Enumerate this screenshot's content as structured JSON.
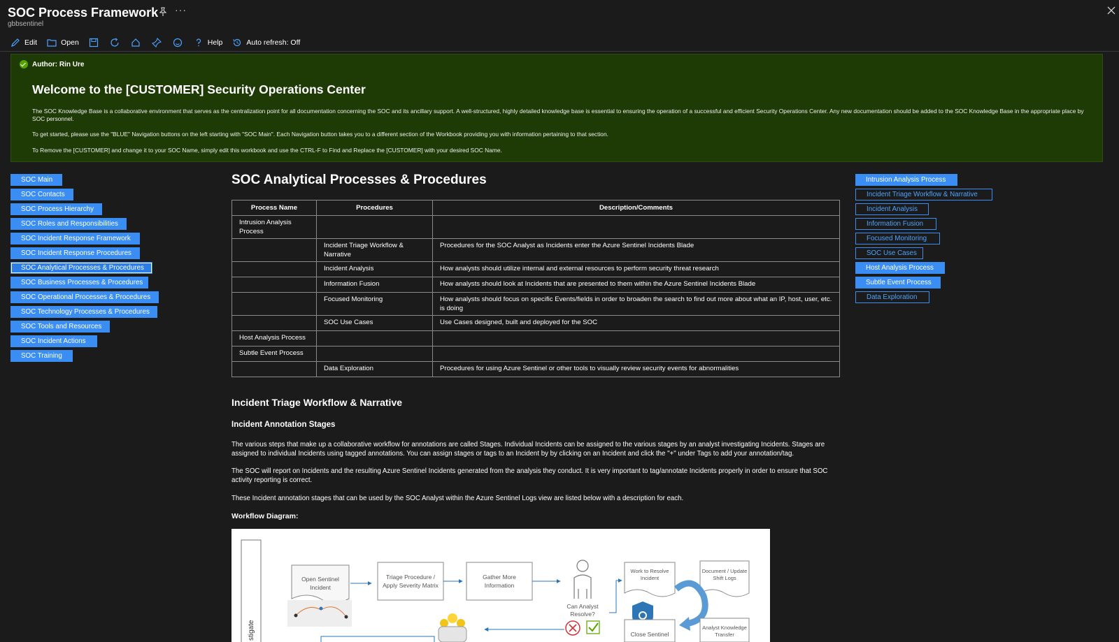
{
  "window": {
    "title": "SOC Process Framework",
    "subtitle": "gbbsentinel"
  },
  "toolbar": {
    "edit": "Edit",
    "open": "Open",
    "help": "Help",
    "auto_refresh": "Auto refresh: Off"
  },
  "banner": {
    "author": "Author: Rin Ure",
    "heading": "Welcome to the [CUSTOMER] Security Operations Center",
    "paragraphs": [
      "The SOC Knowledge Base is a collaborative environment that serves as the centralization point for all documentation concerning the SOC and its ancillary support. A well-structured, highly detailed knowledge base is essential to ensuring the operation of a successful and efficient Security Operations Center. Any new documentation should be added to the SOC Knowledge Base in the appropriate place by SOC personnel.",
      "To get started, please use the \"BLUE\" Navigation buttons on the left starting with \"SOC Main\". Each Navigation button takes you to a different section of the Workbook providing you with information pertaining to that section.",
      "To Remove the [CUSTOMER] and change it to your SOC Name, simply edit this workbook and use the CTRL-F to Find and Replace the [CUSTOMER] with your desired SOC Name."
    ]
  },
  "left_nav": [
    "SOC Main",
    "SOC Contacts",
    "SOC Process Hierarchy",
    "SOC Roles and Responsibilities",
    "SOC Incident Response Framework",
    "SOC Incident Response Procedures",
    "SOC Analytical Processes & Procedures",
    "SOC Business Processes & Procedures",
    "SOC Operational Processes & Procedures",
    "SOC Technology Processes & Procedures",
    "SOC Tools and Resources",
    "SOC Incident Actions",
    "SOC Training"
  ],
  "right_nav": [
    "Intrusion Analysis Process",
    "Incident Triage Workflow & Narrative",
    "Incident Analysis",
    "Information Fusion",
    "Focused Monitoring",
    "SOC Use Cases",
    "Host Analysis Process",
    "Subtle Event Process",
    "Data Exploration"
  ],
  "main": {
    "title": "SOC Analytical Processes & Procedures",
    "table": {
      "headers": [
        "Process Name",
        "Procedures",
        "Description/Comments"
      ],
      "rows": [
        [
          "Intrusion Analysis Process",
          "",
          ""
        ],
        [
          "",
          "Incident Triage Workflow & Narrative",
          "Procedures for the SOC Analyst as Incidents enter the Azure Sentinel Incidents Blade"
        ],
        [
          "",
          "Incident Analysis",
          "How analysts should utilize internal and external resources to perform security threat research"
        ],
        [
          "",
          "Information Fusion",
          "How analysts should look at Incidents that are presented to them within the Azure Sentinel Incidents Blade"
        ],
        [
          "",
          "Focused Monitoring",
          "How analysts should focus on specific Events/fields in order to broaden the search to find out more about what an IP, host, user, etc. is doing"
        ],
        [
          "",
          "SOC Use Cases",
          "Use Cases designed, built and deployed for the SOC"
        ],
        [
          "Host Analysis Process",
          "",
          ""
        ],
        [
          "Subtle Event Process",
          "",
          ""
        ],
        [
          "",
          "Data Exploration",
          "Procedures for using Azure Sentinel or other tools to visually review security events for abnormalities"
        ]
      ]
    },
    "section_title": "Incident Triage Workflow & Narrative",
    "subsection_title": "Incident Annotation Stages",
    "paragraphs": [
      "The various steps that make up a collaborative workflow for annotations are called Stages. Individual Incidents can be assigned to the various stages by an analyst investigating Incidents. Stages are assigned to individual Incidents using tagged annotations. You can assign stages or tags to an Incident by by clicking on an Incident and click the \"+\" under Tags to add your annotation/tag.",
      "The SOC will report on Incidents and the resulting Azure Sentinel Incidents generated from the analysis they conduct. It is very important to tag/annotate Incidents properly in order to ensure that SOC activity reporting is correct.",
      "These Incident annotation stages that can be used by the SOC Analyst within the Azure Sentinel Logs view are listed below with a description for each."
    ],
    "workflow_label": "Workflow Diagram:"
  },
  "diagram": {
    "open_incident": [
      "Open Sentinel",
      "Incident"
    ],
    "triage": [
      "Triage Procedure /",
      "Apply Severity Matrix"
    ],
    "gather": [
      "Gather More",
      "Information"
    ],
    "can_resolve": [
      "Can Analyst",
      "Resolve?"
    ],
    "work_resolve": [
      "Work to Resolve",
      "Incident"
    ],
    "document": [
      "Document / Update",
      "Shift Logs"
    ],
    "close": "Close Sentinel",
    "knowledge": [
      "Analyst Knowledge",
      "Transfer"
    ],
    "lane": "stigate"
  },
  "colors": {
    "background": "#1b1b1b",
    "banner": "#1e3b05",
    "accent": "#3a8df2",
    "check": "#57a300"
  },
  "icons": [
    "pin-icon",
    "more-icon",
    "close-icon",
    "edit-icon",
    "open-icon",
    "save-icon",
    "refresh-icon",
    "cloud-icon",
    "pin-toolbar-icon",
    "smiley-icon",
    "help-icon",
    "history-icon",
    "check-icon",
    "shield-icon"
  ]
}
